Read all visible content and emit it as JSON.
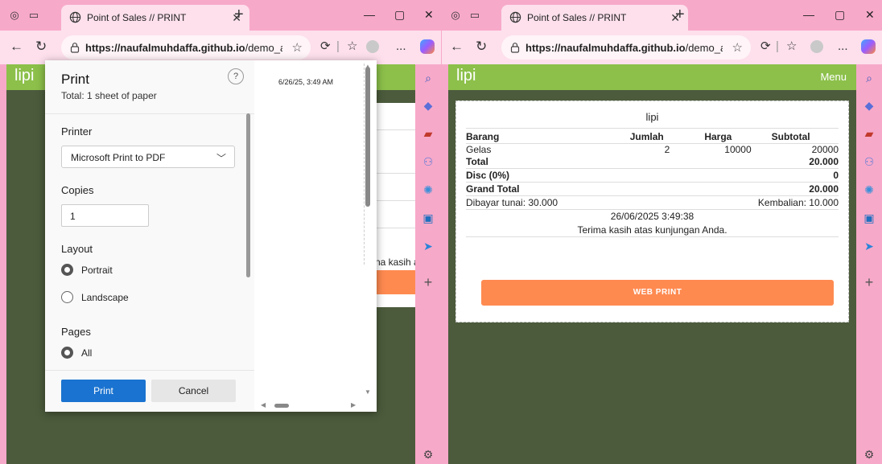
{
  "browser": {
    "tab_title": "Point of Sales // PRINT",
    "url_host": "https://naufalmuhdaffa.github.io",
    "url_path": "/demo_albar...",
    "more_label": "..."
  },
  "app": {
    "brand": "lipi",
    "menu_label": "Menu"
  },
  "background_page": {
    "fragment_text": "na kasih a"
  },
  "print_dialog": {
    "title": "Print",
    "summary": "Total: 1 sheet of paper",
    "help_label": "?",
    "printer_label": "Printer",
    "printer_value": "Microsoft Print to PDF",
    "copies_label": "Copies",
    "copies_value": "1",
    "layout_label": "Layout",
    "layout_portrait": "Portrait",
    "layout_landscape": "Landscape",
    "pages_label": "Pages",
    "pages_all": "All",
    "print_button": "Print",
    "cancel_button": "Cancel",
    "preview_date": "6/26/25, 3:49 AM"
  },
  "receipt": {
    "store": "lipi",
    "headers": [
      "Barang",
      "Jumlah",
      "Harga",
      "Subtotal"
    ],
    "items": [
      {
        "name": "Gelas",
        "qty": "2",
        "price": "10000",
        "subtotal": "20000"
      }
    ],
    "total_label": "Total",
    "total_value": "20.000",
    "disc_label": "Disc (0%)",
    "disc_value": "0",
    "grand_label": "Grand Total",
    "grand_value": "20.000",
    "paid": "Dibayar tunai: 30.000",
    "change": "Kembalian: 10.000",
    "datetime": "26/06/2025 3:49:38",
    "thanks": "Terima kasih atas kunjungan Anda.",
    "web_print_label": "WEB PRINT"
  }
}
